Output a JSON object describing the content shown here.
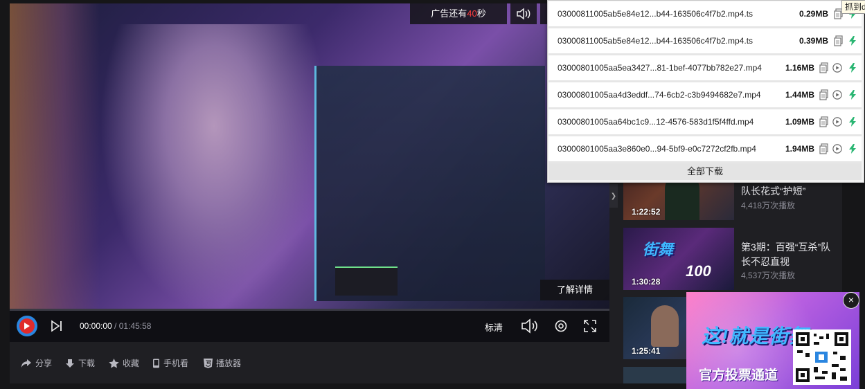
{
  "ad": {
    "countdown_prefix": "广告还有",
    "countdown_seconds": "40",
    "countdown_suffix": "秒",
    "learn_more": "了解详情"
  },
  "player": {
    "current_time": "00:00:00",
    "separator": " / ",
    "duration": "01:45:58",
    "quality": "标清",
    "icons": [
      "play-logo-icon",
      "next-icon",
      "volume-icon",
      "settings-icon",
      "fullscreen-icon",
      "ad-volume-icon"
    ]
  },
  "actions": [
    {
      "label": "分享",
      "icon": "share-icon"
    },
    {
      "label": "下载",
      "icon": "download-icon"
    },
    {
      "label": "收藏",
      "icon": "star-icon"
    },
    {
      "label": "手机看",
      "icon": "phone-icon"
    },
    {
      "label": "播放器",
      "icon": "html5-icon"
    }
  ],
  "download_popup": {
    "tooltip": "抓到d",
    "files": [
      {
        "name": "03000811005ab5e84e12...b44-163506c4f7b2.mp4.ts",
        "size": "0.29MB",
        "has_play": false
      },
      {
        "name": "03000811005ab5e84e12...b44-163506c4f7b2.mp4.ts",
        "size": "0.39MB",
        "has_play": false
      },
      {
        "name": "03000801005aa5ea3427...81-1bef-4077bb782e27.mp4",
        "size": "1.16MB",
        "has_play": true
      },
      {
        "name": "03000801005aa4d3eddf...74-6cb2-c3b9494682e7.mp4",
        "size": "1.44MB",
        "has_play": true
      },
      {
        "name": "03000801005aa64bc1c9...12-4576-583d1f5f4ffd.mp4",
        "size": "1.09MB",
        "has_play": true
      },
      {
        "name": "03000801005aa3e860e0...94-5bf9-e0c7272cf2fb.mp4",
        "size": "1.94MB",
        "has_play": true
      }
    ],
    "download_all": "全部下载"
  },
  "recommendations": [
    {
      "title": "队长花式“护短”",
      "views": "4,418万次播放",
      "duration": "1:22:52"
    },
    {
      "title": "第3期：百强“互杀”队长不忍直视",
      "views": "4,537万次播放",
      "duration": "1:30:28"
    },
    {
      "title": "",
      "views": "",
      "duration": "1:25:41"
    }
  ],
  "corner_ad": {
    "brand": "这!就是街舞",
    "sub": "官方投票通道",
    "close": "×"
  },
  "colors": {
    "accent_red": "#ff3d3d",
    "download_green": "#2bb673",
    "logo_blue": "#2a86e0"
  }
}
